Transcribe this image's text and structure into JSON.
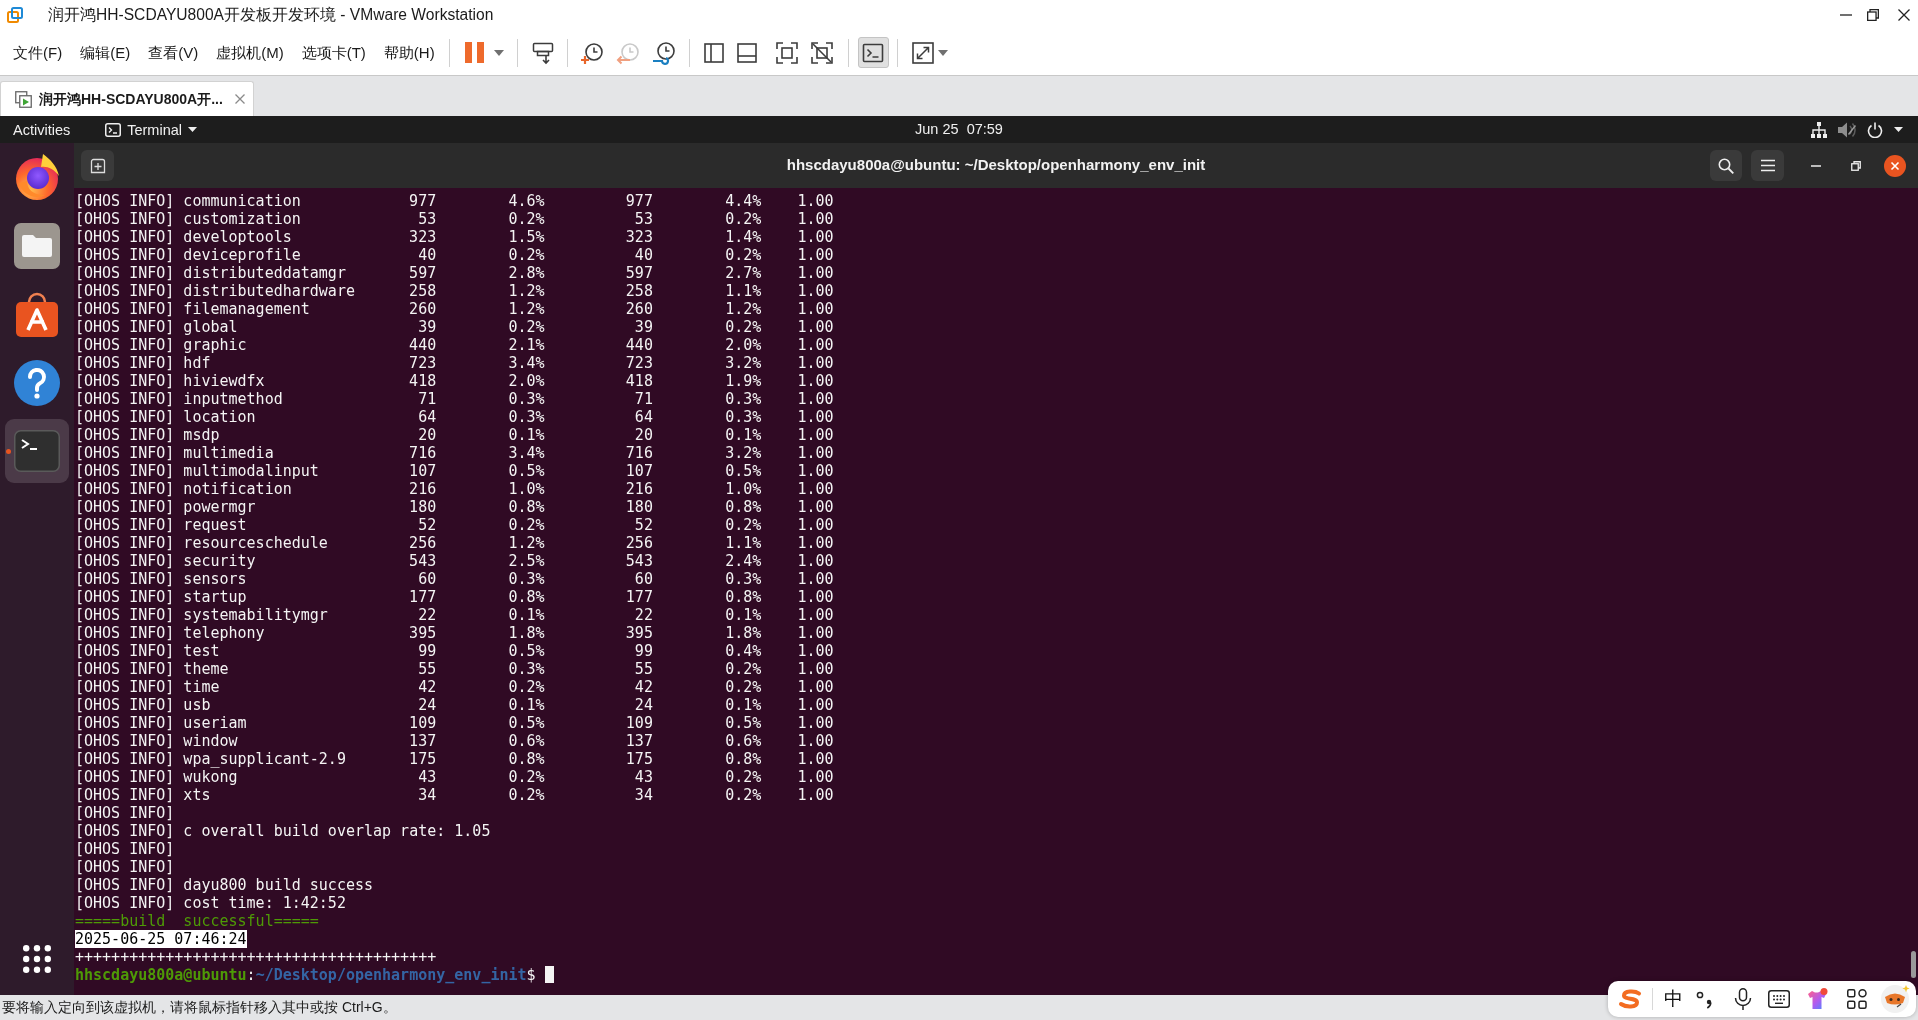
{
  "window": {
    "title": "润开鸿HH-SCDAYU800A开发板开发环境 - VMware Workstation"
  },
  "menu": [
    "文件(F)",
    "编辑(E)",
    "查看(V)",
    "虚拟机(M)",
    "选项卡(T)",
    "帮助(H)"
  ],
  "toolbar": {
    "console_view": {
      "pressed": true
    }
  },
  "tabs": [
    {
      "label": "润开鸿HH-SCDAYU800A开...",
      "selected": true
    }
  ],
  "guest": {
    "top_bar": {
      "activities": "Activities",
      "app_menu": "Terminal",
      "clock": "Jun 25  07:59"
    },
    "dock": [
      {
        "kind": "browser",
        "selected": false,
        "running": false
      },
      {
        "kind": "files",
        "selected": false,
        "running": false
      },
      {
        "kind": "software",
        "selected": false,
        "running": false
      },
      {
        "kind": "help",
        "selected": false,
        "running": false
      },
      {
        "kind": "terminal",
        "selected": true,
        "running": true
      }
    ],
    "terminal": {
      "title": "hhscdayu800a@ubuntu: ~/Desktop/openharmony_env_init",
      "lines": [
        {
          "kind": "stats",
          "prefix": "[OHOS INFO]",
          "cells": [
            "communication",
            "977",
            "4.6%",
            "977",
            "4.4%",
            "1.00"
          ]
        },
        {
          "kind": "stats",
          "prefix": "[OHOS INFO]",
          "cells": [
            "customization",
            "53",
            "0.2%",
            "53",
            "0.2%",
            "1.00"
          ]
        },
        {
          "kind": "stats",
          "prefix": "[OHOS INFO]",
          "cells": [
            "developtools",
            "323",
            "1.5%",
            "323",
            "1.4%",
            "1.00"
          ]
        },
        {
          "kind": "stats",
          "prefix": "[OHOS INFO]",
          "cells": [
            "deviceprofile",
            "40",
            "0.2%",
            "40",
            "0.2%",
            "1.00"
          ]
        },
        {
          "kind": "stats",
          "prefix": "[OHOS INFO]",
          "cells": [
            "distributeddatamgr",
            "597",
            "2.8%",
            "597",
            "2.7%",
            "1.00"
          ]
        },
        {
          "kind": "stats",
          "prefix": "[OHOS INFO]",
          "cells": [
            "distributedhardware",
            "258",
            "1.2%",
            "258",
            "1.1%",
            "1.00"
          ]
        },
        {
          "kind": "stats",
          "prefix": "[OHOS INFO]",
          "cells": [
            "filemanagement",
            "260",
            "1.2%",
            "260",
            "1.2%",
            "1.00"
          ]
        },
        {
          "kind": "stats",
          "prefix": "[OHOS INFO]",
          "cells": [
            "global",
            "39",
            "0.2%",
            "39",
            "0.2%",
            "1.00"
          ]
        },
        {
          "kind": "stats",
          "prefix": "[OHOS INFO]",
          "cells": [
            "graphic",
            "440",
            "2.1%",
            "440",
            "2.0%",
            "1.00"
          ]
        },
        {
          "kind": "stats",
          "prefix": "[OHOS INFO]",
          "cells": [
            "hdf",
            "723",
            "3.4%",
            "723",
            "3.2%",
            "1.00"
          ]
        },
        {
          "kind": "stats",
          "prefix": "[OHOS INFO]",
          "cells": [
            "hiviewdfx",
            "418",
            "2.0%",
            "418",
            "1.9%",
            "1.00"
          ]
        },
        {
          "kind": "stats",
          "prefix": "[OHOS INFO]",
          "cells": [
            "inputmethod",
            "71",
            "0.3%",
            "71",
            "0.3%",
            "1.00"
          ]
        },
        {
          "kind": "stats",
          "prefix": "[OHOS INFO]",
          "cells": [
            "location",
            "64",
            "0.3%",
            "64",
            "0.3%",
            "1.00"
          ]
        },
        {
          "kind": "stats",
          "prefix": "[OHOS INFO]",
          "cells": [
            "msdp",
            "20",
            "0.1%",
            "20",
            "0.1%",
            "1.00"
          ]
        },
        {
          "kind": "stats",
          "prefix": "[OHOS INFO]",
          "cells": [
            "multimedia",
            "716",
            "3.4%",
            "716",
            "3.2%",
            "1.00"
          ]
        },
        {
          "kind": "stats",
          "prefix": "[OHOS INFO]",
          "cells": [
            "multimodalinput",
            "107",
            "0.5%",
            "107",
            "0.5%",
            "1.00"
          ]
        },
        {
          "kind": "stats",
          "prefix": "[OHOS INFO]",
          "cells": [
            "notification",
            "216",
            "1.0%",
            "216",
            "1.0%",
            "1.00"
          ]
        },
        {
          "kind": "stats",
          "prefix": "[OHOS INFO]",
          "cells": [
            "powermgr",
            "180",
            "0.8%",
            "180",
            "0.8%",
            "1.00"
          ]
        },
        {
          "kind": "stats",
          "prefix": "[OHOS INFO]",
          "cells": [
            "request",
            "52",
            "0.2%",
            "52",
            "0.2%",
            "1.00"
          ]
        },
        {
          "kind": "stats",
          "prefix": "[OHOS INFO]",
          "cells": [
            "resourceschedule",
            "256",
            "1.2%",
            "256",
            "1.1%",
            "1.00"
          ]
        },
        {
          "kind": "stats",
          "prefix": "[OHOS INFO]",
          "cells": [
            "security",
            "543",
            "2.5%",
            "543",
            "2.4%",
            "1.00"
          ]
        },
        {
          "kind": "stats",
          "prefix": "[OHOS INFO]",
          "cells": [
            "sensors",
            "60",
            "0.3%",
            "60",
            "0.3%",
            "1.00"
          ]
        },
        {
          "kind": "stats",
          "prefix": "[OHOS INFO]",
          "cells": [
            "startup",
            "177",
            "0.8%",
            "177",
            "0.8%",
            "1.00"
          ]
        },
        {
          "kind": "stats",
          "prefix": "[OHOS INFO]",
          "cells": [
            "systemabilitymgr",
            "22",
            "0.1%",
            "22",
            "0.1%",
            "1.00"
          ]
        },
        {
          "kind": "stats",
          "prefix": "[OHOS INFO]",
          "cells": [
            "telephony",
            "395",
            "1.8%",
            "395",
            "1.8%",
            "1.00"
          ]
        },
        {
          "kind": "stats",
          "prefix": "[OHOS INFO]",
          "cells": [
            "test",
            "99",
            "0.5%",
            "99",
            "0.4%",
            "1.00"
          ]
        },
        {
          "kind": "stats",
          "prefix": "[OHOS INFO]",
          "cells": [
            "theme",
            "55",
            "0.3%",
            "55",
            "0.2%",
            "1.00"
          ]
        },
        {
          "kind": "stats",
          "prefix": "[OHOS INFO]",
          "cells": [
            "time",
            "42",
            "0.2%",
            "42",
            "0.2%",
            "1.00"
          ]
        },
        {
          "kind": "stats",
          "prefix": "[OHOS INFO]",
          "cells": [
            "usb",
            "24",
            "0.1%",
            "24",
            "0.1%",
            "1.00"
          ]
        },
        {
          "kind": "stats",
          "prefix": "[OHOS INFO]",
          "cells": [
            "useriam",
            "109",
            "0.5%",
            "109",
            "0.5%",
            "1.00"
          ]
        },
        {
          "kind": "stats",
          "prefix": "[OHOS INFO]",
          "cells": [
            "window",
            "137",
            "0.6%",
            "137",
            "0.6%",
            "1.00"
          ]
        },
        {
          "kind": "stats",
          "prefix": "[OHOS INFO]",
          "cells": [
            "wpa_supplicant-2.9",
            "175",
            "0.8%",
            "175",
            "0.8%",
            "1.00"
          ]
        },
        {
          "kind": "stats",
          "prefix": "[OHOS INFO]",
          "cells": [
            "wukong",
            "43",
            "0.2%",
            "43",
            "0.2%",
            "1.00"
          ]
        },
        {
          "kind": "stats",
          "prefix": "[OHOS INFO]",
          "cells": [
            "xts",
            "34",
            "0.2%",
            "34",
            "0.2%",
            "1.00"
          ]
        },
        {
          "kind": "text",
          "text": "[OHOS INFO]",
          "selected": false
        },
        {
          "kind": "text",
          "text": "[OHOS INFO] c overall build overlap rate: 1.05",
          "selected": false
        },
        {
          "kind": "text",
          "text": "[OHOS INFO]",
          "selected": false
        },
        {
          "kind": "text",
          "text": "[OHOS INFO]",
          "selected": false
        },
        {
          "kind": "text",
          "text": "[OHOS INFO] dayu800 build success",
          "selected": false
        },
        {
          "kind": "text",
          "text": "[OHOS INFO] cost time: 1:42:52",
          "selected": false
        },
        {
          "kind": "success",
          "text": "=====build  successful====="
        },
        {
          "kind": "text",
          "text": "2025-06-25 07:46:24",
          "selected": true
        },
        {
          "kind": "text",
          "text": "++++++++++++++++++++++++++++++++++++++++",
          "selected": false
        },
        {
          "kind": "prompt",
          "user": "hhscdayu800a@ubuntu",
          "separator": ":",
          "path": "~/Desktop/openharmony_env_init",
          "symbol": "$"
        }
      ]
    }
  },
  "status_bar": {
    "text": "要将输入定向到该虚拟机，请将鼠标指针移入其中或按 Ctrl+G。"
  },
  "ime_bar": {
    "mode": "中"
  }
}
